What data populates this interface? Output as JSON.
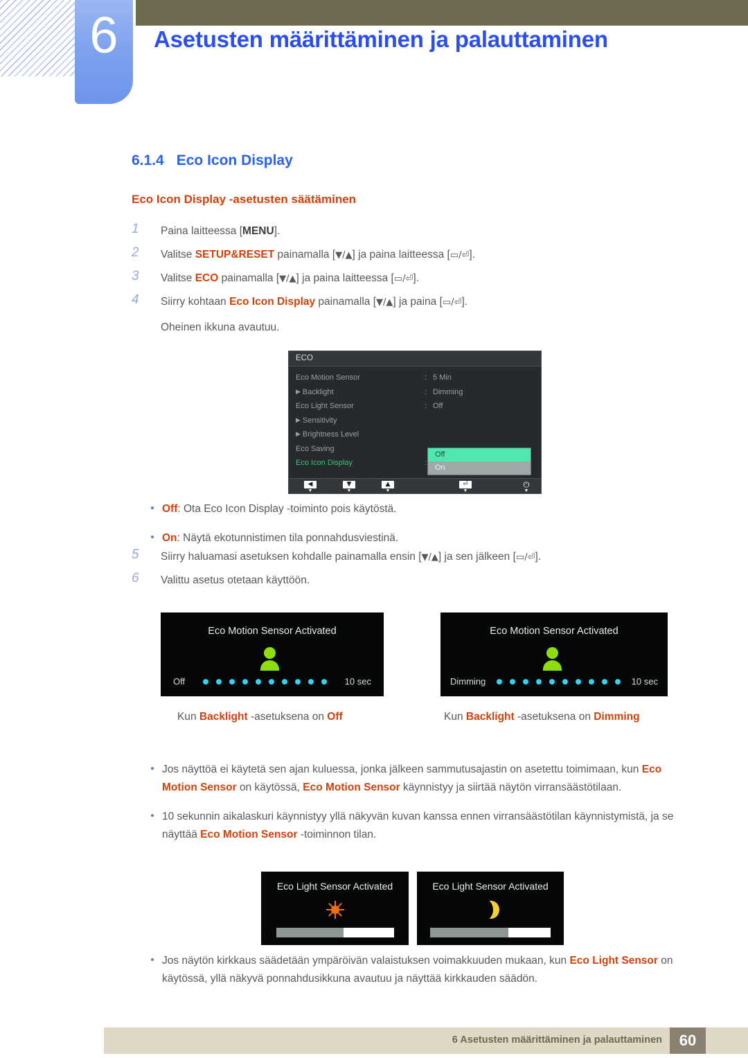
{
  "header": {
    "chapter_number": "6",
    "chapter_title": "Asetusten määrittäminen ja palauttaminen"
  },
  "section": {
    "number": "6.1.4",
    "title": "Eco Icon Display",
    "subtitle": "Eco Icon Display -asetusten säätäminen"
  },
  "steps": [
    {
      "index": "1",
      "parts": [
        {
          "t": "Paina laitteessa [",
          "s": "plain"
        },
        {
          "t": "MENU",
          "s": "kb"
        },
        {
          "t": "].",
          "s": "plain"
        }
      ]
    },
    {
      "index": "2",
      "parts": [
        {
          "t": "Valitse ",
          "s": "plain"
        },
        {
          "t": "SETUP&RESET",
          "s": "hl"
        },
        {
          "t": " painamalla [",
          "s": "plain"
        },
        {
          "t": "▼/▲",
          "s": "gly"
        },
        {
          "t": "] ja paina laitteessa [",
          "s": "plain"
        },
        {
          "t": "▭/⏎",
          "s": "gly"
        },
        {
          "t": "].",
          "s": "plain"
        }
      ]
    },
    {
      "index": "3",
      "parts": [
        {
          "t": "Valitse ",
          "s": "plain"
        },
        {
          "t": "ECO",
          "s": "hl"
        },
        {
          "t": " painamalla [",
          "s": "plain"
        },
        {
          "t": "▼/▲",
          "s": "gly"
        },
        {
          "t": "] ja paina laitteessa [",
          "s": "plain"
        },
        {
          "t": "▭/⏎",
          "s": "gly"
        },
        {
          "t": "].",
          "s": "plain"
        }
      ]
    },
    {
      "index": "4",
      "parts": [
        {
          "t": "Siirry kohtaan ",
          "s": "plain"
        },
        {
          "t": "Eco Icon Display",
          "s": "hl"
        },
        {
          "t": " painamalla [",
          "s": "plain"
        },
        {
          "t": "▼/▲",
          "s": "gly"
        },
        {
          "t": "] ja paina [",
          "s": "plain"
        },
        {
          "t": "▭/⏎",
          "s": "gly"
        },
        {
          "t": "].",
          "s": "plain"
        }
      ]
    }
  ],
  "step4_note": "Oheinen ikkuna avautuu.",
  "osd": {
    "header_label": "ECO",
    "rows": [
      {
        "label": "Eco Motion Sensor",
        "arrow": false,
        "colon": ":",
        "value": "5 Min",
        "selected": false
      },
      {
        "label": "Backlight",
        "arrow": true,
        "colon": ":",
        "value": "Dimming",
        "selected": false
      },
      {
        "label": "Eco Light Sensor",
        "arrow": false,
        "colon": ":",
        "value": "Off",
        "selected": false
      },
      {
        "label": "Sensitivity",
        "arrow": true,
        "colon": "",
        "value": "",
        "selected": false
      },
      {
        "label": "Brightness Level",
        "arrow": true,
        "colon": "",
        "value": "",
        "selected": false
      },
      {
        "label": "Eco Saving",
        "arrow": false,
        "colon": "",
        "value": "",
        "selected": false
      },
      {
        "label": "Eco Icon Display",
        "arrow": false,
        "colon": ":",
        "value": "",
        "selected": true
      }
    ],
    "dropdown": {
      "option_selected": "Off",
      "option_other": "On"
    },
    "footer_buttons": [
      {
        "name": "left-arrow",
        "glyph": "◀"
      },
      {
        "name": "down-arrow",
        "glyph": "▼"
      },
      {
        "name": "up-arrow",
        "glyph": "▲"
      },
      {
        "name": "enter",
        "glyph": "⏎"
      },
      {
        "name": "power",
        "glyph": "⏻"
      }
    ],
    "colors": {
      "highlight_green": "#4fe8ae",
      "selected_text": "#3fbf7f"
    }
  },
  "option_bullets": [
    {
      "parts": [
        {
          "t": "Off",
          "s": "hl"
        },
        {
          "t": ": Ota Eco Icon Display -toiminto pois käytöstä.",
          "s": "plain"
        }
      ]
    },
    {
      "parts": [
        {
          "t": "On",
          "s": "hl"
        },
        {
          "t": ": Näytä ekotunnistimen tila ponnahdusviestinä.",
          "s": "plain"
        }
      ]
    }
  ],
  "steps2": [
    {
      "index": "5",
      "parts": [
        {
          "t": "Siirry haluamasi asetuksen kohdalle painamalla ensin [",
          "s": "plain"
        },
        {
          "t": "▼/▲",
          "s": "gly"
        },
        {
          "t": "] ja sen jälkeen [",
          "s": "plain"
        },
        {
          "t": "▭/⏎",
          "s": "gly"
        },
        {
          "t": "].",
          "s": "plain"
        }
      ]
    },
    {
      "index": "6",
      "parts": [
        {
          "t": "Valittu asetus otetaan käyttöön.",
          "s": "plain"
        }
      ]
    }
  ],
  "motion_popups": [
    {
      "title": "Eco Motion Sensor Activated",
      "left_label": "Off",
      "right_label": "10 sec",
      "dot_count": 10
    },
    {
      "title": "Eco Motion Sensor Activated",
      "left_label": "Dimming",
      "right_label": "10 sec",
      "dot_count": 10
    }
  ],
  "motion_captions": [
    {
      "parts": [
        {
          "t": "Kun ",
          "s": "plain"
        },
        {
          "t": "Backlight",
          "s": "hl"
        },
        {
          "t": " -asetuksena on ",
          "s": "plain"
        },
        {
          "t": "Off",
          "s": "hl"
        }
      ]
    },
    {
      "parts": [
        {
          "t": "Kun ",
          "s": "plain"
        },
        {
          "t": "Backlight",
          "s": "hl"
        },
        {
          "t": " -asetuksena on ",
          "s": "plain"
        },
        {
          "t": "Dimming",
          "s": "hl"
        }
      ]
    }
  ],
  "note_bullets": [
    {
      "parts": [
        {
          "t": "Jos näyttöä ei käytetä sen ajan kuluessa, jonka jälkeen sammutusajastin on asetettu toimimaan, kun ",
          "s": "plain"
        },
        {
          "t": "Eco Motion Sensor",
          "s": "hl"
        },
        {
          "t": " on käytössä, ",
          "s": "plain"
        },
        {
          "t": "Eco Motion Sensor",
          "s": "hl"
        },
        {
          "t": " käynnistyy ja siirtää näytön virransäästötilaan.",
          "s": "plain"
        }
      ]
    },
    {
      "parts": [
        {
          "t": "10 sekunnin aikalaskuri käynnistyy yllä näkyvän kuvan kanssa ennen virransäästötilan käynnistymistä, ja se näyttää ",
          "s": "plain"
        },
        {
          "t": "Eco Motion Sensor",
          "s": "hl"
        },
        {
          "t": " -toiminnon tilan.",
          "s": "plain"
        }
      ]
    }
  ],
  "light_popups": [
    {
      "title": "Eco Light Sensor Activated",
      "icon": "sun-icon",
      "progress_percent": 57
    },
    {
      "title": "Eco Light Sensor Activated",
      "icon": "moon-icon",
      "progress_percent": 65
    }
  ],
  "final_bullet": {
    "parts": [
      {
        "t": "Jos näytön kirkkaus säädetään ympäröivän valaistuksen voimakkuuden mukaan, kun ",
        "s": "plain"
      },
      {
        "t": "Eco Light Sensor",
        "s": "hl"
      },
      {
        "t": " on käytössä, yllä näkyvä ponnahdusikkuna avautuu ja näyttää kirkkauden säädön.",
        "s": "plain"
      }
    ]
  },
  "footer": {
    "text": "6 Asetusten määrittäminen ja palauttaminen",
    "page": "60"
  }
}
